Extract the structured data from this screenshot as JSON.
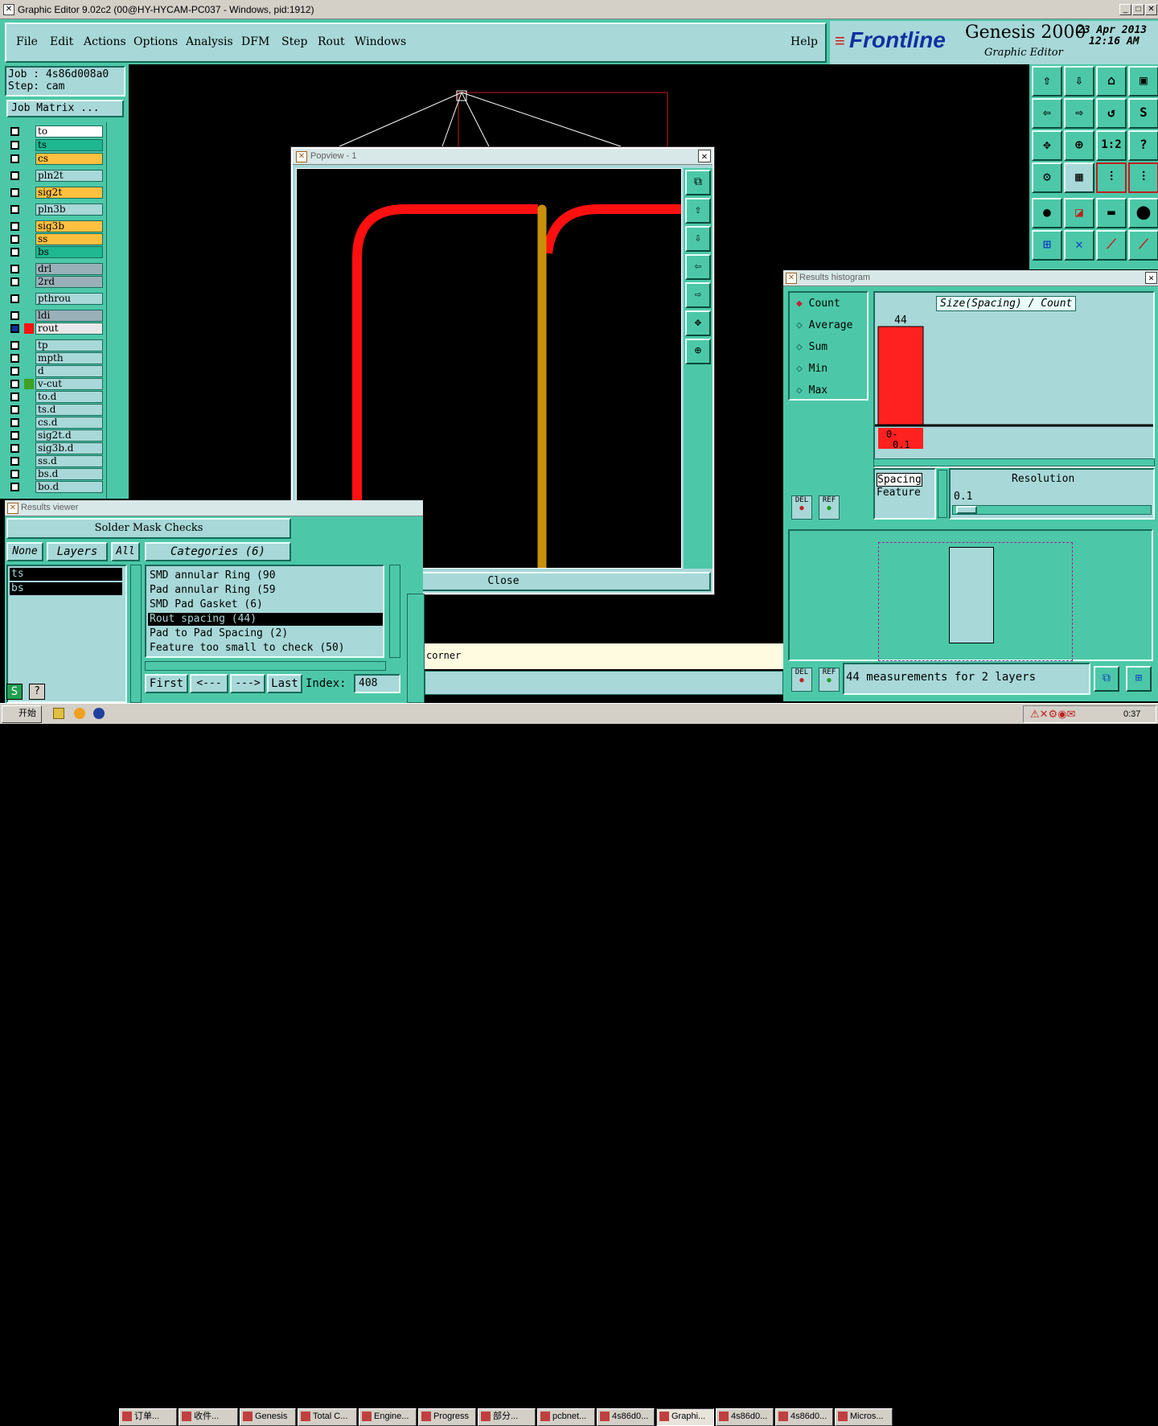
{
  "window": {
    "title": "Graphic Editor 9.02c2 (00@HY-HYCAM-PC037 - Windows, pid:1912)"
  },
  "menu": {
    "file": "File",
    "edit": "Edit",
    "actions": "Actions",
    "options": "Options",
    "analysis": "Analysis",
    "dfm": "DFM",
    "step": "Step",
    "rout": "Rout",
    "windows": "Windows",
    "help": "Help"
  },
  "brand": {
    "logo": "Frontline",
    "product": "Genesis 2000",
    "subtitle": "Graphic Editor",
    "date": "23 Apr 2013",
    "time": "12:16 AM"
  },
  "job": {
    "job_line": "Job : 4s86d008a0",
    "step_line": "Step: cam",
    "matrix_button": "Job Matrix ..."
  },
  "layers": [
    {
      "name": "to",
      "color": "#ffffff"
    },
    {
      "name": "ts",
      "color": "#1fb890"
    },
    {
      "name": "cs",
      "color": "#ffc040"
    },
    {
      "name": "pln2t",
      "color": "#a8d8d8"
    },
    {
      "name": "sig2t",
      "color": "#ffc040"
    },
    {
      "name": "pln3b",
      "color": "#a8d8d8"
    },
    {
      "name": "sig3b",
      "color": "#ffc040"
    },
    {
      "name": "ss",
      "color": "#ffc040"
    },
    {
      "name": "bs",
      "color": "#1fb890"
    },
    {
      "name": "drl",
      "color": "#9ab0b8"
    },
    {
      "name": "2rd",
      "color": "#9ab0b8"
    },
    {
      "name": "pthrou",
      "color": "#a8d8d8"
    },
    {
      "name": "ldi",
      "color": "#9ab0b8"
    },
    {
      "name": "rout",
      "color": "#e8e8e8"
    },
    {
      "name": "tp",
      "color": "#a8d8d8"
    },
    {
      "name": "mpth",
      "color": "#a8d8d8"
    },
    {
      "name": "d",
      "color": "#a8d8d8"
    },
    {
      "name": "v-cut",
      "color": "#a8d8d8"
    },
    {
      "name": "to.d",
      "color": "#a8d8d8"
    },
    {
      "name": "ts.d",
      "color": "#a8d8d8"
    },
    {
      "name": "cs.d",
      "color": "#a8d8d8"
    },
    {
      "name": "sig2t.d",
      "color": "#a8d8d8"
    },
    {
      "name": "sig3b.d",
      "color": "#a8d8d8"
    },
    {
      "name": "ss.d",
      "color": "#a8d8d8"
    },
    {
      "name": "bs.d",
      "color": "#a8d8d8"
    },
    {
      "name": "bo.d",
      "color": "#a8d8d8"
    }
  ],
  "popview": {
    "title": "Popview - 1",
    "close": "Close"
  },
  "results_viewer": {
    "title": "Results viewer",
    "heading": "Solder Mask Checks",
    "none": "None",
    "layers": "Layers",
    "all": "All",
    "categories_header": "Categories (6)",
    "layer_list": [
      "ts",
      "bs"
    ],
    "categories": [
      "SMD annular Ring (90",
      "Pad annular Ring (59",
      "SMD Pad Gasket (6)",
      "Rout spacing (44)",
      "Pad to Pad Spacing (2)",
      "Feature too small to check (50)"
    ],
    "selected_category": "Rout spacing (44)",
    "first": "First",
    "prev": "<---",
    "next": "--->",
    "last": "Last",
    "index_label": "Index:",
    "index_value": "408"
  },
  "status": {
    "text": "corner"
  },
  "histogram": {
    "title": "Results histogram",
    "modes": [
      "Count",
      "Average",
      "Sum",
      "Min",
      "Max"
    ],
    "selected_mode": "Count",
    "chart_title": "Size(Spacing) / Count",
    "bar_value": "44",
    "bar_label_1": "0-",
    "bar_label_2": "0.1",
    "spacing_label": "Spacing",
    "feature_label": "Feature",
    "resolution_label": "Resolution",
    "resolution_value": "0.1",
    "del": "DEL",
    "ref": "REF",
    "measurements": "44 measurements for 2 layers"
  },
  "chart_data": {
    "type": "bar",
    "title": "Size(Spacing) / Count",
    "categories": [
      "0-0.1"
    ],
    "values": [
      44
    ],
    "color": "#ff2020"
  },
  "taskbar": {
    "start": "开始",
    "buttons": [
      "订单...",
      "收件...",
      "Genesis",
      "Total C...",
      "Engine...",
      "Progress",
      "部分...",
      "pcbnet...",
      "4s86d0...",
      "Graphi...",
      "4s86d0...",
      "4s86d0...",
      "Micros..."
    ],
    "clock": "0:37"
  }
}
